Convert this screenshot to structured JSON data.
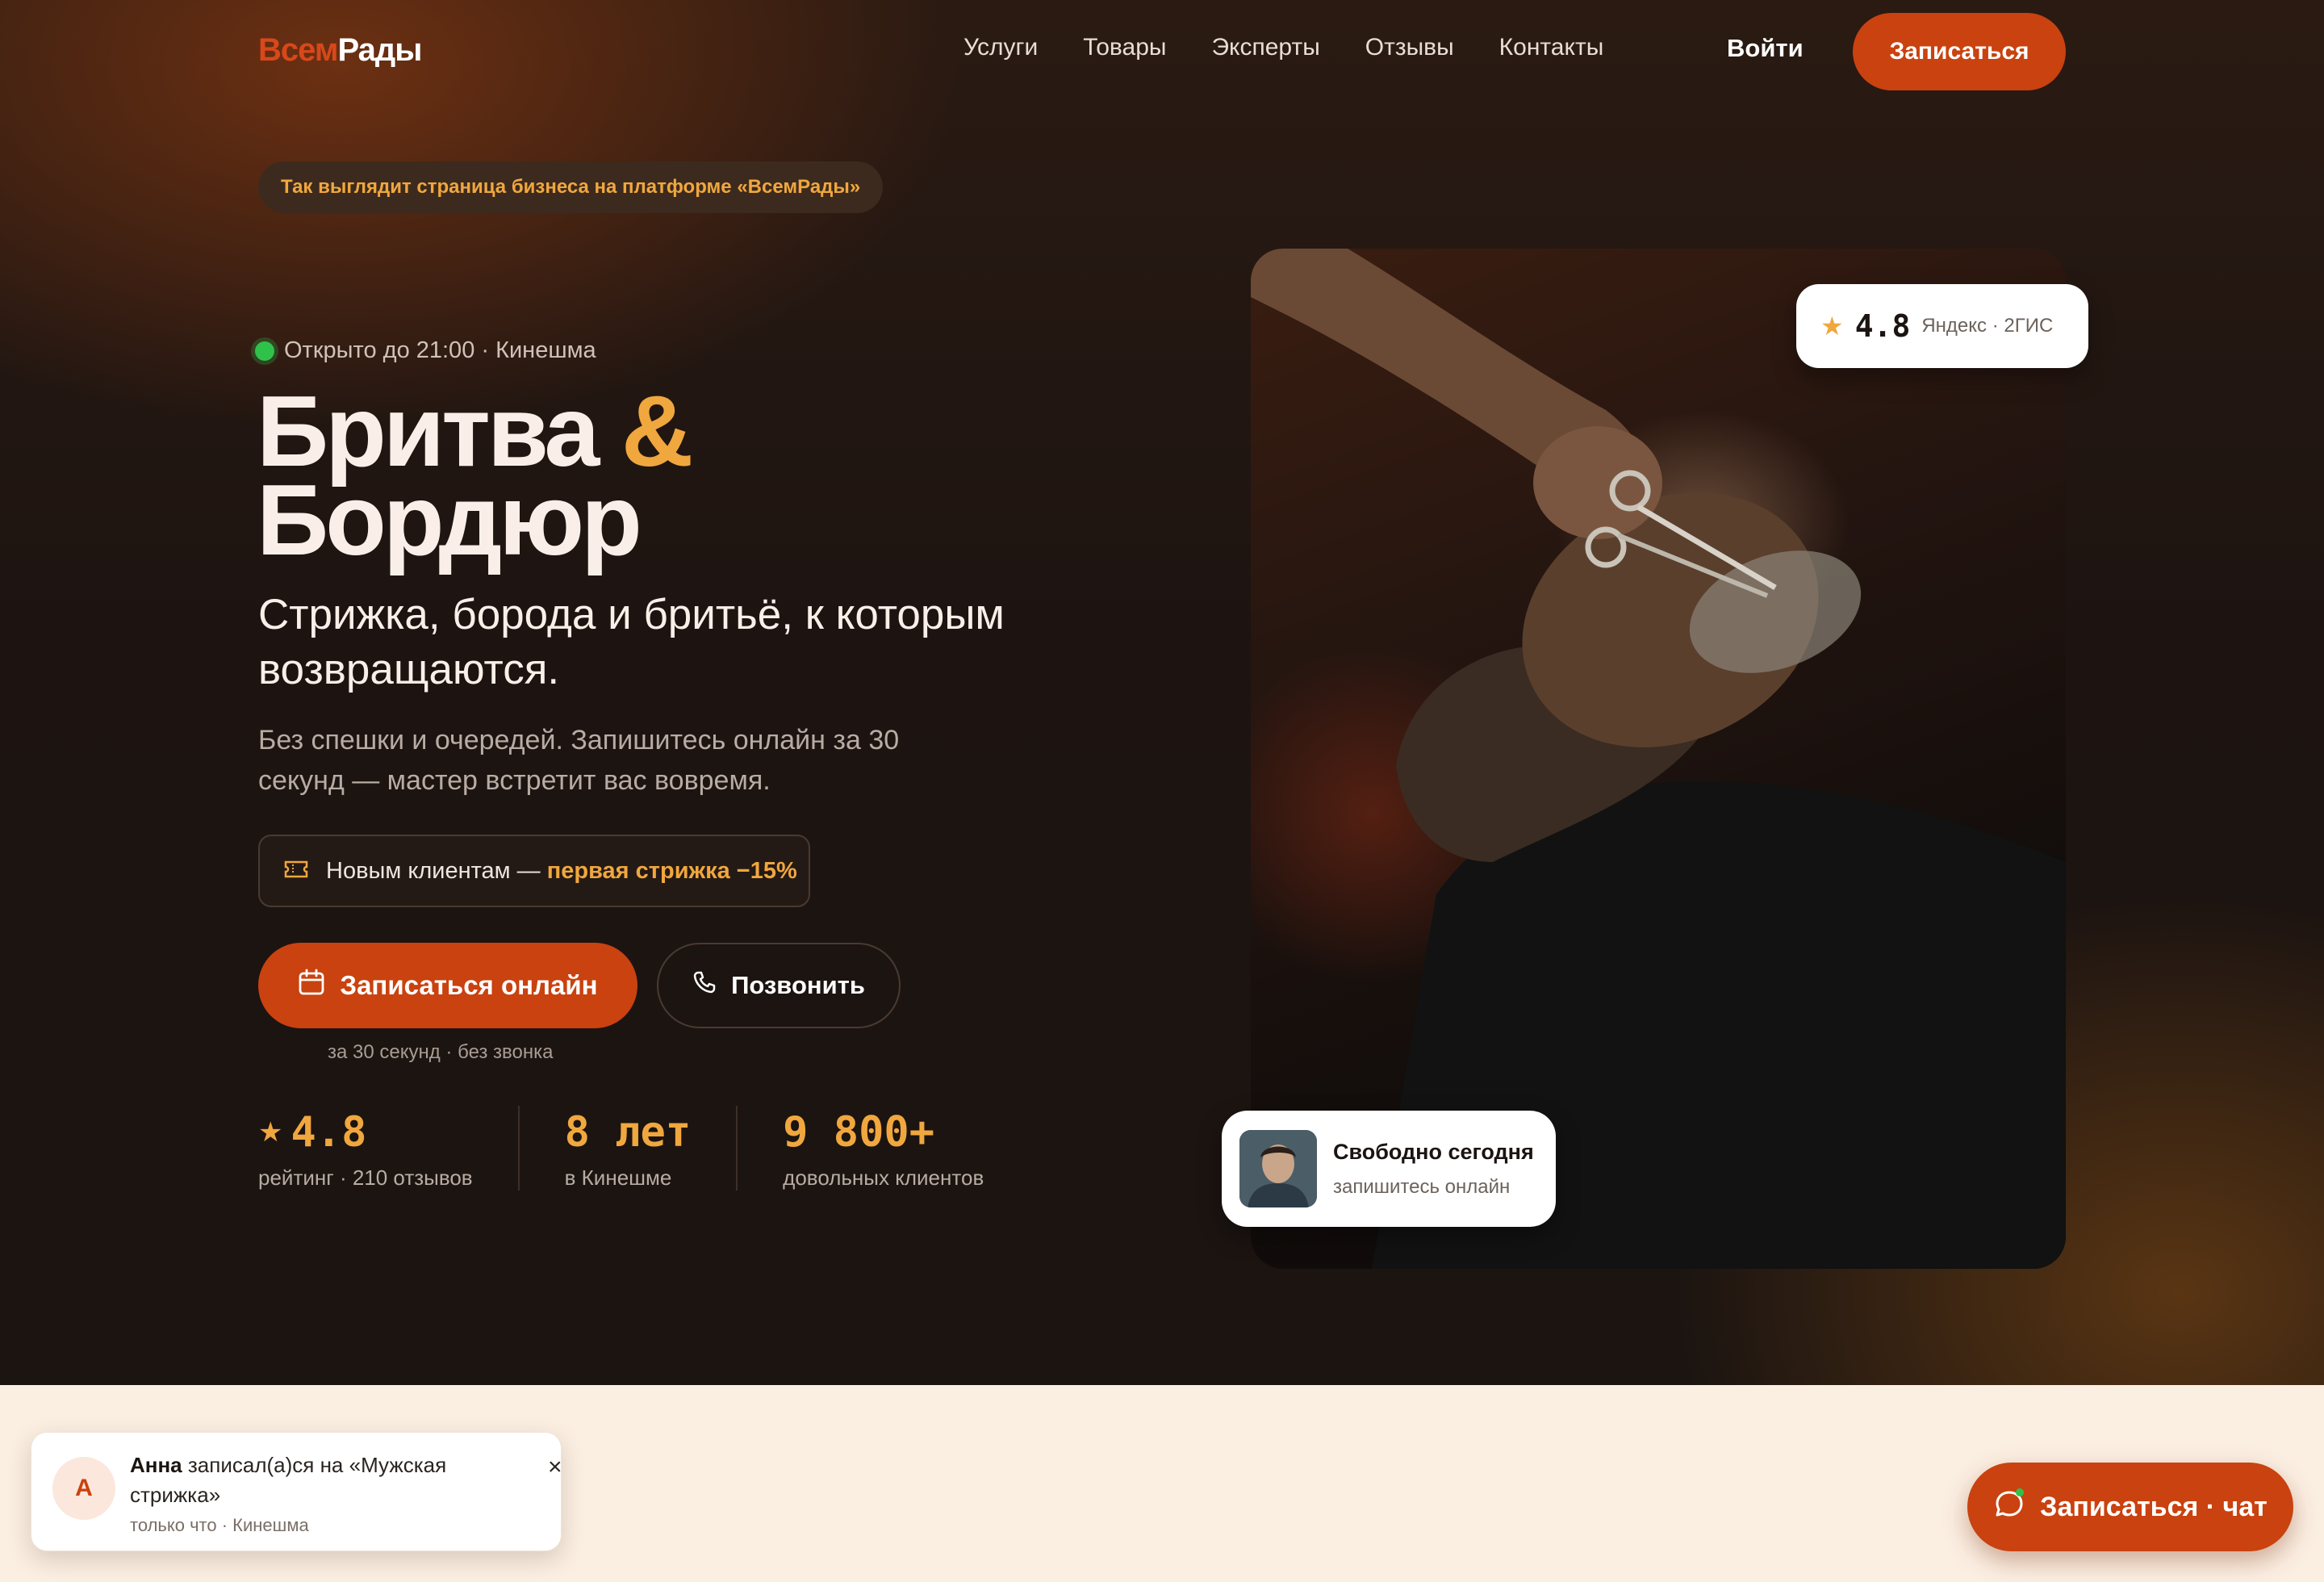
{
  "brand": {
    "logo_part1": "Всем",
    "logo_part2": "Рады"
  },
  "nav": {
    "items": [
      "Услуги",
      "Товары",
      "Эксперты",
      "Отзывы",
      "Контакты"
    ]
  },
  "header": {
    "login": "Войти",
    "cta": "Записаться"
  },
  "platform_pill": "Так выглядит страница бизнеса на платформе «ВсемРады»",
  "status": {
    "text": "Открыто до 21:00 · Кинешма"
  },
  "hero": {
    "title_line1": "Бритва",
    "title_amp": "&",
    "title_line2": "Бордюр",
    "subtitle": "Стрижка, борода и бритьё, к которым возвращаются.",
    "description": "Без спешки и очередей. Запишитесь онлайн за 30 секунд — мастер встретит вас вовремя."
  },
  "promo": {
    "prefix": "Новым клиентам — ",
    "highlight": "первая стрижка −15%"
  },
  "actions": {
    "primary": "Записаться онлайн",
    "secondary": "Позвонить",
    "note": "за 30 секунд · без звонка"
  },
  "stats": [
    {
      "value": "4.8",
      "label": "рейтинг · 210 отзывов"
    },
    {
      "value": "8 лет",
      "label": "в Кинешме"
    },
    {
      "value": "9 800+",
      "label": "довольных клиентов"
    }
  ],
  "rating_card": {
    "value": "4.8",
    "source": "Яндекс · 2ГИС"
  },
  "free_card": {
    "title": "Свободно сегодня",
    "subtitle": "запишитесь онлайн"
  },
  "toast": {
    "avatar_letter": "А",
    "name": "Анна",
    "message": " записал(а)ся на «Мужская стрижка»",
    "meta": "только что · Кинешма",
    "close": "×"
  },
  "chat_button": {
    "label": "Записаться · чат"
  },
  "colors": {
    "accent": "#c9420f",
    "gold": "#f0a73e",
    "background": "#1b1411",
    "cream": "#fbefe2",
    "online": "#2fc24b"
  },
  "icons": [
    "star-icon",
    "ticket-icon",
    "calendar-icon",
    "phone-icon",
    "chat-icon",
    "close-icon"
  ]
}
